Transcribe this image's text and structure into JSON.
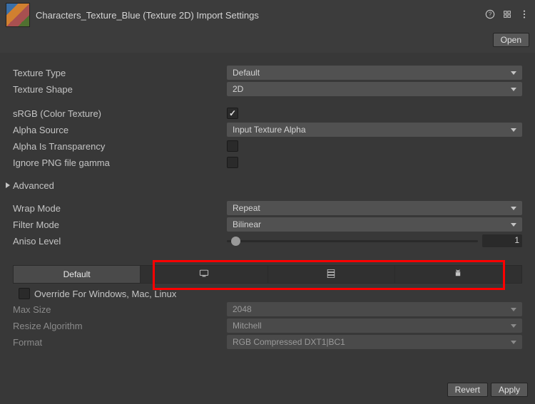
{
  "header": {
    "title": "Characters_Texture_Blue (Texture 2D) Import Settings",
    "open_label": "Open"
  },
  "fields": {
    "texture_type": {
      "label": "Texture Type",
      "value": "Default"
    },
    "texture_shape": {
      "label": "Texture Shape",
      "value": "2D"
    },
    "srgb": {
      "label": "sRGB (Color Texture)",
      "checked": true
    },
    "alpha_source": {
      "label": "Alpha Source",
      "value": "Input Texture Alpha"
    },
    "alpha_is_trans": {
      "label": "Alpha Is Transparency",
      "checked": false
    },
    "ignore_png_gamma": {
      "label": "Ignore PNG file gamma",
      "checked": false
    },
    "advanced": {
      "label": "Advanced"
    },
    "wrap_mode": {
      "label": "Wrap Mode",
      "value": "Repeat"
    },
    "filter_mode": {
      "label": "Filter Mode",
      "value": "Bilinear"
    },
    "aniso": {
      "label": "Aniso Level",
      "value": "1"
    }
  },
  "platform": {
    "default_label": "Default",
    "override_label": "Override For Windows, Mac, Linux",
    "override_checked": false,
    "max_size": {
      "label": "Max Size",
      "value": "2048"
    },
    "resize_algo": {
      "label": "Resize Algorithm",
      "value": "Mitchell"
    },
    "format": {
      "label": "Format",
      "value": "RGB Compressed DXT1|BC1"
    }
  },
  "footer": {
    "revert": "Revert",
    "apply": "Apply"
  }
}
